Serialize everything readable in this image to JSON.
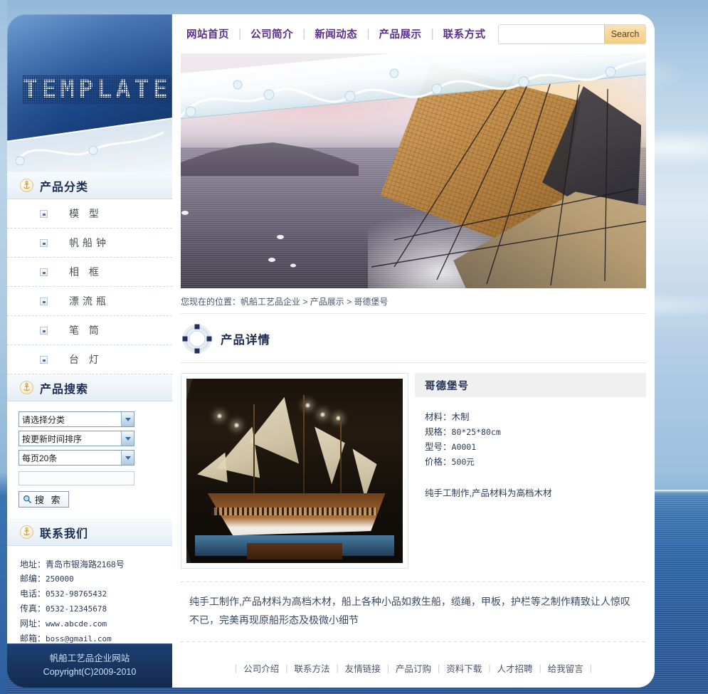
{
  "site": {
    "logo_text": "TEMPLATE",
    "copyright_line1": "帆船工艺品企业网站",
    "copyright_line2": "Copyright(C)2009-2010"
  },
  "topnav": {
    "items": [
      {
        "label": "网站首页"
      },
      {
        "label": "公司简介"
      },
      {
        "label": "新闻动态"
      },
      {
        "label": "产品展示"
      },
      {
        "label": "联系方式"
      }
    ],
    "separator": "|",
    "search": {
      "value": "",
      "placeholder": "",
      "button_label": "Search"
    }
  },
  "sidebar": {
    "categories": {
      "heading": "产品分类",
      "items": [
        {
          "label": "模 型"
        },
        {
          "label": "帆船钟"
        },
        {
          "label": "相 框"
        },
        {
          "label": "漂流瓶"
        },
        {
          "label": "笔 筒"
        },
        {
          "label": "台 灯"
        }
      ]
    },
    "product_search": {
      "heading": "产品搜索",
      "select_category": "请选择分类",
      "select_sort": "按更新时间排序",
      "select_pagesize": "每页20条",
      "keyword_value": "",
      "keyword_placeholder": "",
      "button_label": "搜 索"
    },
    "contact": {
      "heading": "联系我们",
      "rows": [
        {
          "label": "地址：",
          "value": "青岛市银海路2168号",
          "mono": false
        },
        {
          "label": "邮编：",
          "value": "250000",
          "mono": true
        },
        {
          "label": "电话：",
          "value": "0532-98765432",
          "mono": true
        },
        {
          "label": "传真：",
          "value": "0532-12345678",
          "mono": true
        },
        {
          "label": "网址：",
          "value": "www.abcde.com",
          "mono": true
        },
        {
          "label": "邮箱：",
          "value": "boss@gmail.com",
          "mono": true
        }
      ]
    }
  },
  "main": {
    "breadcrumb": {
      "prefix": "您现在的位置：",
      "items": [
        "帆船工艺品企业",
        "产品展示",
        "哥德堡号"
      ],
      "separator": ">"
    },
    "section_title": "产品详情",
    "product": {
      "name": "哥德堡号",
      "specs": [
        {
          "label": "材料：",
          "value": "木制",
          "mono": false
        },
        {
          "label": "规格：",
          "value": "80*25*80cm",
          "mono": true
        },
        {
          "label": "型号：",
          "value": "A0001",
          "mono": true
        },
        {
          "label": "价格：",
          "value": "500元",
          "mono": true
        }
      ],
      "short_note": "纯手工制作,产品材料为高档木材",
      "description": "纯手工制作,产品材料为高档木材，船上各种小品如救生船，缆绳，甲板，护栏等之制作精致让人惊叹不已，完美再现原船形态及极微小细节"
    }
  },
  "footer": {
    "links": [
      {
        "label": "公司介绍"
      },
      {
        "label": "联系方法"
      },
      {
        "label": "友情链接"
      },
      {
        "label": "产品订购"
      },
      {
        "label": "资料下载"
      },
      {
        "label": "人才招聘"
      },
      {
        "label": "给我留言"
      }
    ],
    "separator": "|"
  },
  "colors": {
    "nav_link": "#5b2f8a",
    "heading_navy": "#1e2d52",
    "search_button": "#f6d79a",
    "logo_panel_blue": "#1d4a8c",
    "footer_blue": "#18355f"
  }
}
